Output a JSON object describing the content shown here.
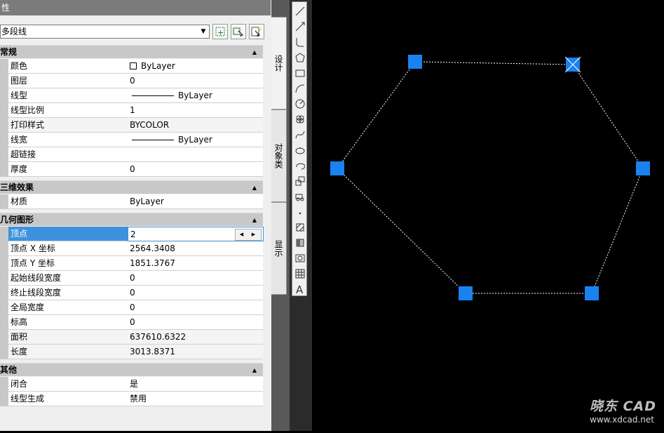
{
  "palette": {
    "title": "性",
    "object_select": "多段线",
    "categories": {
      "general": "常规",
      "threed": "三维效果",
      "geometry": "几何图形",
      "misc": "其他"
    },
    "general_rows": [
      {
        "name": "颜色",
        "value": "ByLayer"
      },
      {
        "name": "图层",
        "value": "0"
      },
      {
        "name": "线型",
        "value": "ByLayer"
      },
      {
        "name": "线型比例",
        "value": "1"
      },
      {
        "name": "打印样式",
        "value": "BYCOLOR"
      },
      {
        "name": "线宽",
        "value": "ByLayer"
      },
      {
        "name": "超链接",
        "value": ""
      },
      {
        "name": "厚度",
        "value": "0"
      }
    ],
    "threed_rows": [
      {
        "name": "材质",
        "value": "ByLayer"
      }
    ],
    "geometry_rows": [
      {
        "name": "顶点",
        "value": "2"
      },
      {
        "name": "顶点 X 坐标",
        "value": "2564.3408"
      },
      {
        "name": "顶点 Y 坐标",
        "value": "1851.3767"
      },
      {
        "name": "起始线段宽度",
        "value": "0"
      },
      {
        "name": "终止线段宽度",
        "value": "0"
      },
      {
        "name": "全局宽度",
        "value": "0"
      },
      {
        "name": "标高",
        "value": "0"
      },
      {
        "name": "面积",
        "value": "637610.6322"
      },
      {
        "name": "长度",
        "value": "3013.8371"
      }
    ],
    "misc_rows": [
      {
        "name": "闭合",
        "value": "是"
      },
      {
        "name": "线型生成",
        "value": "禁用"
      }
    ]
  },
  "tabs": {
    "design": "设计",
    "objects": "对象类",
    "display": "显示"
  },
  "watermark": {
    "brand": "晓东 CAD",
    "url": "www.xdcad.net"
  },
  "colors": {
    "grip": "#1a82f0",
    "selection": "#3c92dc",
    "canvas": "#000000"
  }
}
